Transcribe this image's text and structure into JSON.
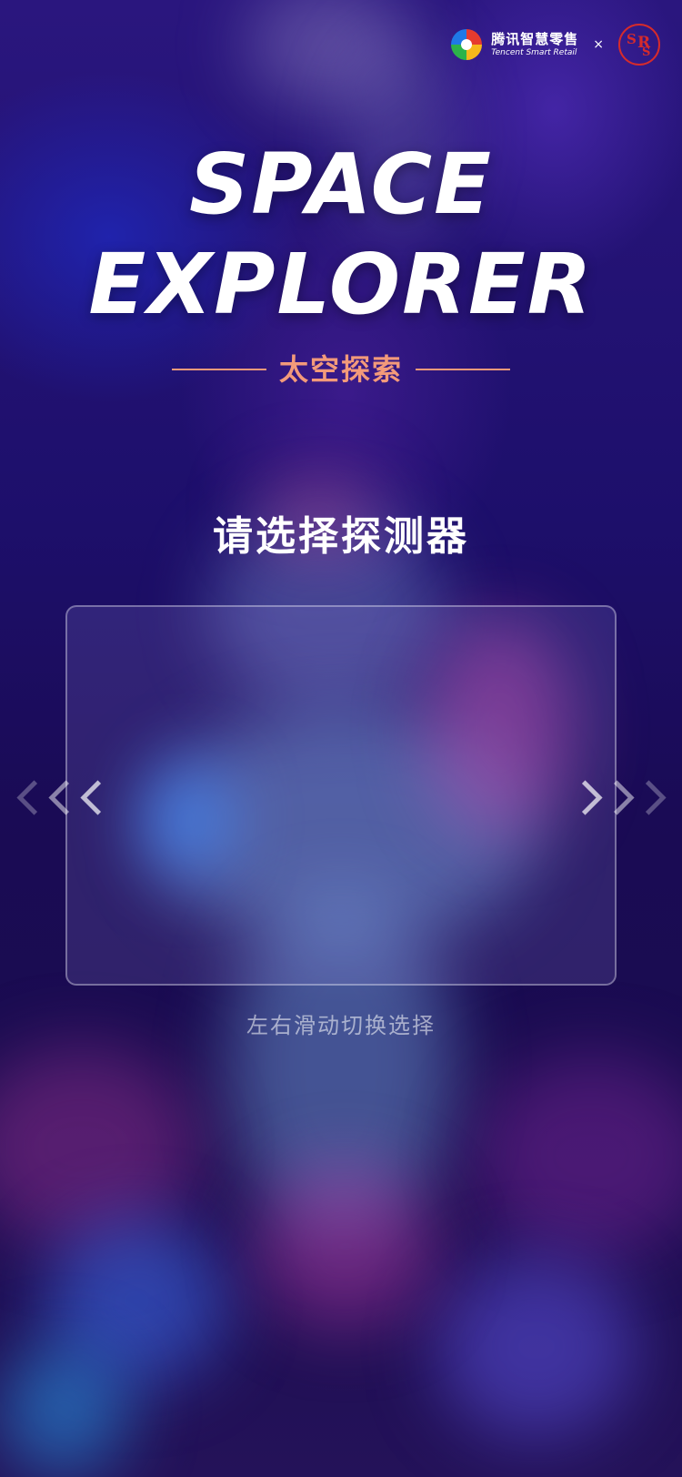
{
  "header": {
    "brand_cn": "腾讯智慧零售",
    "brand_en": "Tencent Smart Retail",
    "separator": "×",
    "partner_letters": [
      "S",
      "R",
      "S"
    ]
  },
  "hero": {
    "title_line1": "SPACE",
    "title_line2": "EXPLORER",
    "subtitle": "太空探索"
  },
  "selector": {
    "prompt": "请选择探测器",
    "hint": "左右滑动切换选择"
  },
  "colors": {
    "accent": "#f39a7a",
    "partner_red": "#d62b2b",
    "background": "#1f0d6a"
  },
  "icons": {
    "left_arrow": "triple-chevron-left-icon",
    "right_arrow": "triple-chevron-right-icon"
  }
}
